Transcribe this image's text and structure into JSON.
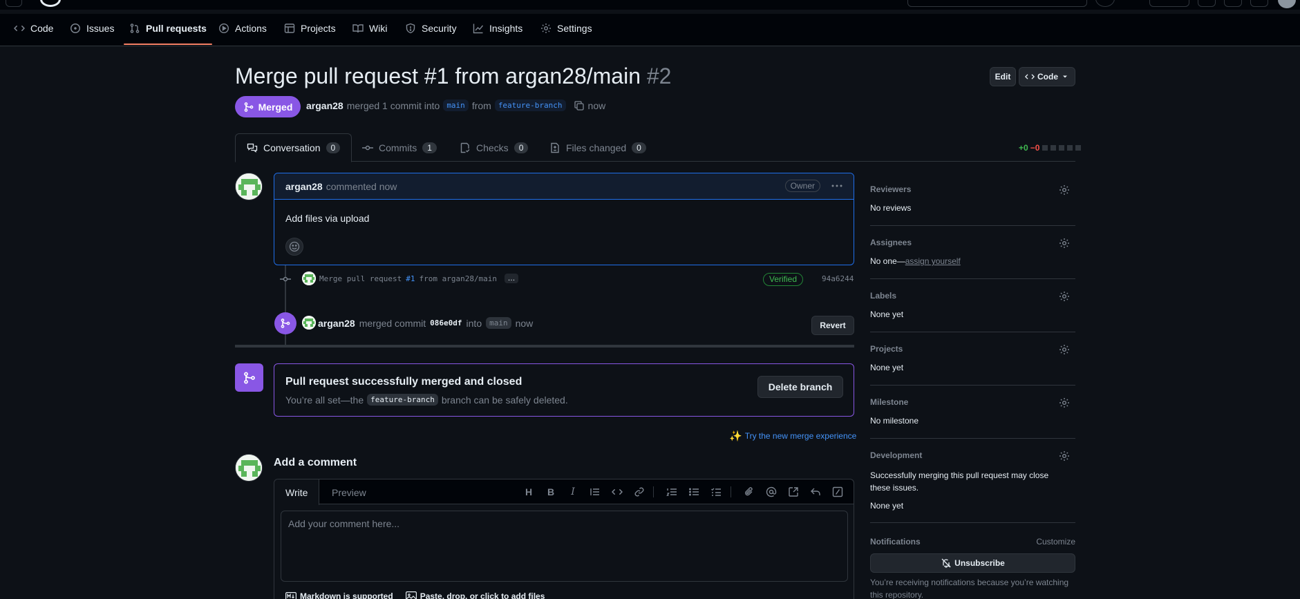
{
  "repo_nav": {
    "tabs": [
      {
        "label": "Code",
        "icon": "code-icon"
      },
      {
        "label": "Issues",
        "icon": "issue-icon"
      },
      {
        "label": "Pull requests",
        "icon": "pull-request-icon",
        "active": true
      },
      {
        "label": "Actions",
        "icon": "play-icon"
      },
      {
        "label": "Projects",
        "icon": "table-icon"
      },
      {
        "label": "Wiki",
        "icon": "book-icon"
      },
      {
        "label": "Security",
        "icon": "shield-icon"
      },
      {
        "label": "Insights",
        "icon": "graph-icon"
      },
      {
        "label": "Settings",
        "icon": "gear-icon"
      }
    ]
  },
  "pr": {
    "title": "Merge pull request #1 from argan28/main",
    "number": "#2",
    "edit_label": "Edit",
    "code_label": "Code",
    "state": "Merged",
    "meta": {
      "author": "argan28",
      "merged_text": "merged 1 commit into",
      "base": "main",
      "from_text": "from",
      "head": "feature-branch",
      "time": "now"
    }
  },
  "pr_tabs": [
    {
      "label": "Conversation",
      "count": "0",
      "icon": "comment-discussion-icon"
    },
    {
      "label": "Commits",
      "count": "1",
      "icon": "commit-icon"
    },
    {
      "label": "Checks",
      "count": "0",
      "icon": "checklist-icon"
    },
    {
      "label": "Files changed",
      "count": "0",
      "icon": "file-diff-icon"
    }
  ],
  "diffstat": {
    "additions": "+0",
    "deletions": "−0"
  },
  "comment": {
    "author": "argan28",
    "meta": "commented now",
    "role": "Owner",
    "body": "Add files via upload"
  },
  "commit": {
    "message_prefix": "Merge pull request",
    "message_ref": "#1",
    "message_suffix": "from argan28/main",
    "ellipsis": "…",
    "verified": "Verified",
    "sha": "94a6244"
  },
  "merge_event": {
    "author": "argan28",
    "text1": "merged commit",
    "sha": "086e0df",
    "text2": "into",
    "branch": "main",
    "time": "now",
    "revert_label": "Revert"
  },
  "merged_box": {
    "title": "Pull request successfully merged and closed",
    "sub_prefix": "You’re all set—the",
    "branch": "feature-branch",
    "sub_suffix": "branch can be safely deleted.",
    "delete_label": "Delete branch"
  },
  "try_link": "Try the new merge experience",
  "add_comment": {
    "title": "Add a comment",
    "write_tab": "Write",
    "preview_tab": "Preview",
    "placeholder": "Add your comment here...",
    "markdown_note": "Markdown is supported",
    "paste_note": "Paste, drop, or click to add files"
  },
  "sidebar": {
    "reviewers": {
      "label": "Reviewers",
      "value": "No reviews"
    },
    "assignees": {
      "label": "Assignees",
      "value": "No one—",
      "link": "assign yourself"
    },
    "labels": {
      "label": "Labels",
      "value": "None yet"
    },
    "projects": {
      "label": "Projects",
      "value": "None yet"
    },
    "milestone": {
      "label": "Milestone",
      "value": "No milestone"
    },
    "development": {
      "label": "Development",
      "description": "Successfully merging this pull request may close these issues.",
      "value": "None yet"
    },
    "notifications": {
      "label": "Notifications",
      "customize": "Customize",
      "unsubscribe": "Unsubscribe",
      "note": "You’re receiving notifications because you’re watching this repository."
    }
  },
  "colors": {
    "accent": "#1f6feb",
    "merged": "#8957e5",
    "nav_underline": "#f78166",
    "link": "#4493f8"
  }
}
